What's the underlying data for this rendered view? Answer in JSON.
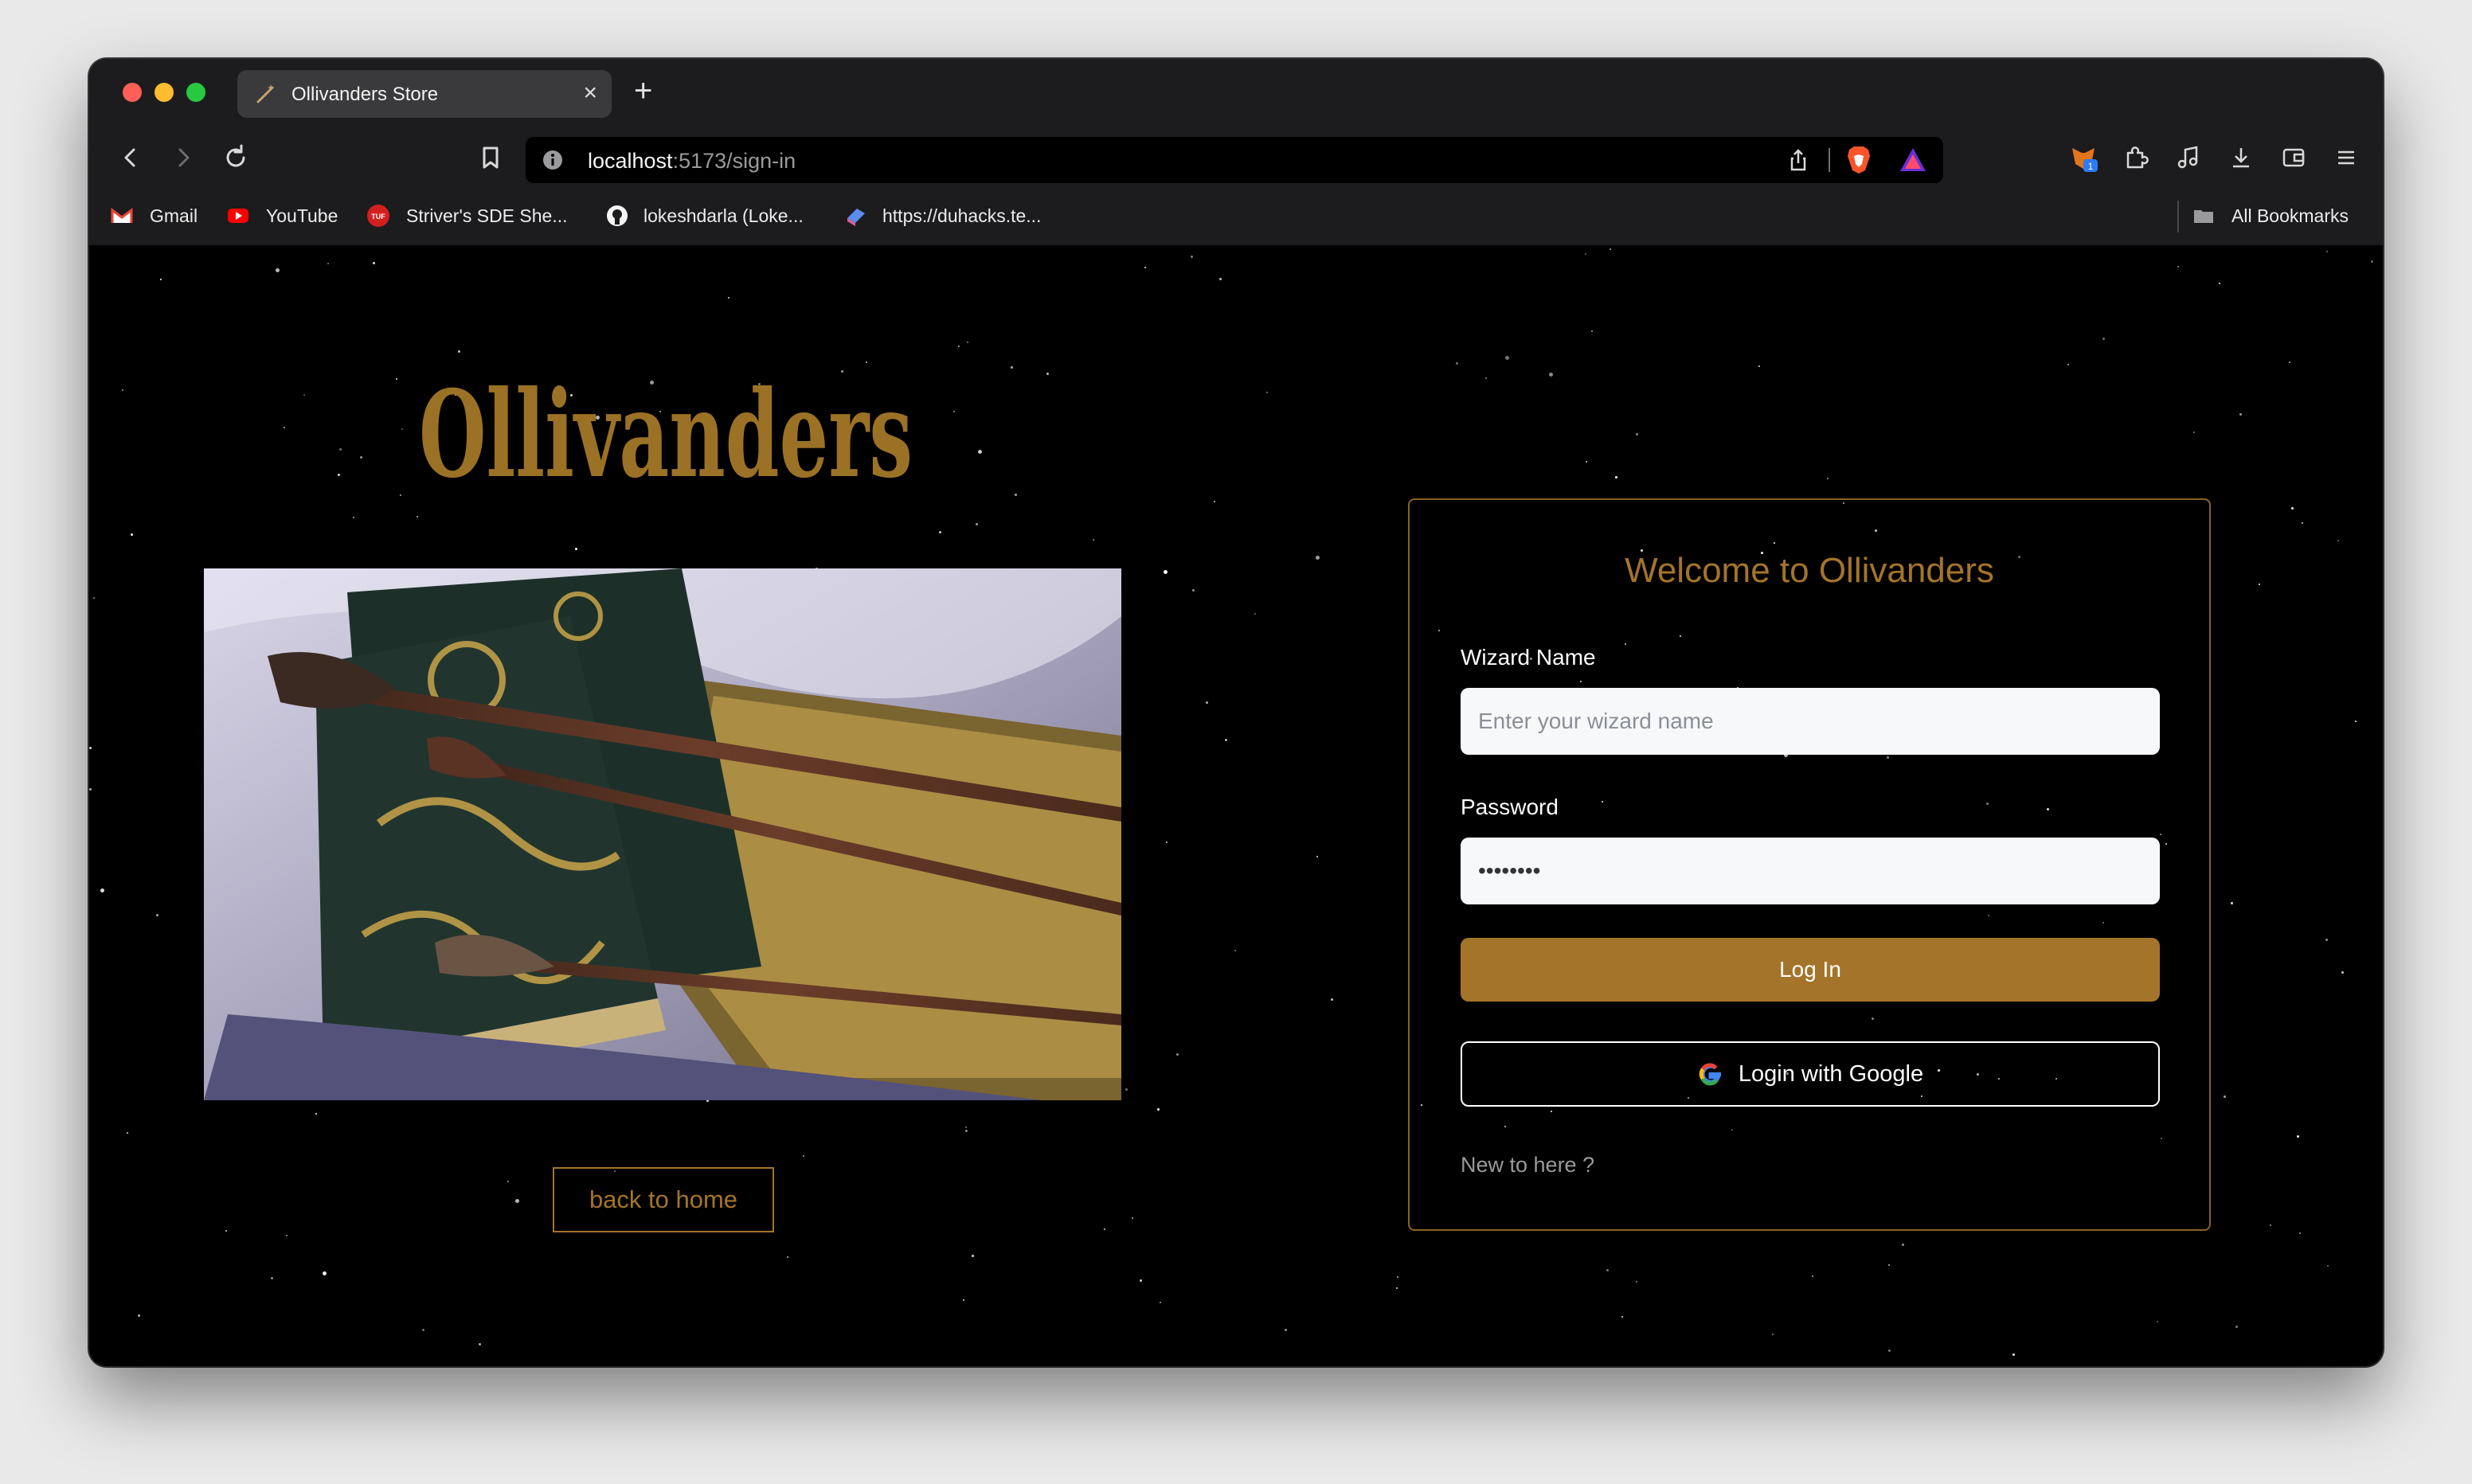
{
  "browser": {
    "tab_title": "Ollivanders Store",
    "tab_close": "×",
    "new_tab": "+",
    "url_host": "localhost",
    "url_path": ":5173/sign-in",
    "extension_badge": "1",
    "bookmarks": [
      {
        "label": "Gmail",
        "icon": "gmail-icon"
      },
      {
        "label": "YouTube",
        "icon": "youtube-icon"
      },
      {
        "label": "Striver's SDE She...",
        "icon": "tuf-icon"
      },
      {
        "label": "lokeshdarla (Loke...",
        "icon": "github-icon"
      },
      {
        "label": "https://duhacks.te...",
        "icon": "duhacks-icon"
      }
    ],
    "all_bookmarks": "All Bookmarks"
  },
  "page": {
    "logo_text": "Ollivanders",
    "back_button": "back to home",
    "card_title": "Welcome to Ollivanders",
    "wizard_label": "Wizard Name",
    "wizard_placeholder": "Enter your wizard name",
    "password_label": "Password",
    "password_value": "password",
    "login_button": "Log In",
    "google_button": "Login with Google",
    "signup_link": "New to here ?"
  },
  "colors": {
    "accent": "#a4742a",
    "background": "#000000",
    "field": "#f7f8fa"
  }
}
